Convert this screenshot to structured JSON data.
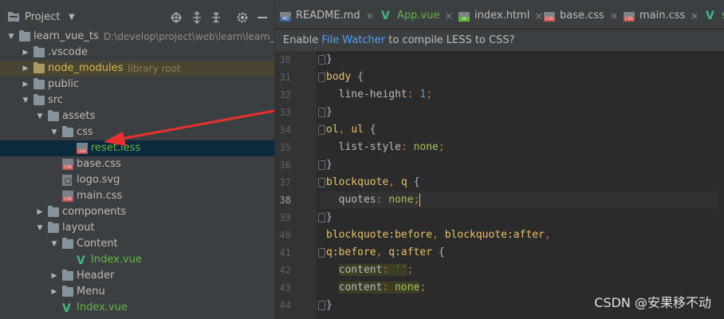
{
  "panel": {
    "title": "Project",
    "buttons": [
      "locate-icon",
      "expand-all-icon",
      "collapse-all-icon",
      "gear-icon",
      "hide-icon"
    ]
  },
  "tree": [
    {
      "label": "learn_vue_ts",
      "hint": "D:\\develop\\project\\web\\learn\\learn_vue",
      "kind": "folder",
      "depth": 0,
      "open": true
    },
    {
      "label": ".vscode",
      "kind": "folder",
      "depth": 1,
      "open": false
    },
    {
      "label": "node_modules",
      "hint": "library root",
      "kind": "folder-nm",
      "depth": 1,
      "open": false
    },
    {
      "label": "public",
      "kind": "folder",
      "depth": 1,
      "open": false
    },
    {
      "label": "src",
      "kind": "folder",
      "depth": 1,
      "open": true
    },
    {
      "label": "assets",
      "kind": "folder",
      "depth": 2,
      "open": true
    },
    {
      "label": "css",
      "kind": "folder",
      "depth": 3,
      "open": true
    },
    {
      "label": "reset.less",
      "kind": "less",
      "depth": 4
    },
    {
      "label": "base.css",
      "kind": "css",
      "depth": 3
    },
    {
      "label": "logo.svg",
      "kind": "svg",
      "depth": 3
    },
    {
      "label": "main.css",
      "kind": "css",
      "depth": 3
    },
    {
      "label": "components",
      "kind": "folder",
      "depth": 2,
      "open": false
    },
    {
      "label": "layout",
      "kind": "folder",
      "depth": 2,
      "open": true
    },
    {
      "label": "Content",
      "kind": "folder",
      "depth": 3,
      "open": true
    },
    {
      "label": "Index.vue",
      "kind": "vue",
      "depth": 4
    },
    {
      "label": "Header",
      "kind": "folder",
      "depth": 3,
      "open": false
    },
    {
      "label": "Menu",
      "kind": "folder",
      "depth": 3,
      "open": false
    },
    {
      "label": "Index.vue",
      "kind": "vue",
      "depth": 3
    }
  ],
  "tabs": [
    {
      "label": "README.md",
      "kind": "md"
    },
    {
      "label": "App.vue",
      "kind": "vue"
    },
    {
      "label": "index.html",
      "kind": "html"
    },
    {
      "label": "base.css",
      "kind": "css"
    },
    {
      "label": "main.css",
      "kind": "css"
    },
    {
      "label": "s",
      "kind": "vue"
    }
  ],
  "notice": {
    "before": "Enable ",
    "link": "File Watcher",
    "after": " to compile LESS to CSS?"
  },
  "code": {
    "current_line": 38,
    "lines": [
      {
        "n": "30",
        "tokens": [
          [
            "brace",
            "}"
          ]
        ]
      },
      {
        "n": "31",
        "tokens": [
          [
            "sel",
            "body"
          ],
          [
            "brace",
            " {"
          ]
        ]
      },
      {
        "n": "32",
        "tokens": [
          [
            "prop",
            "  line-height"
          ],
          [
            "pun",
            ": "
          ],
          [
            "num",
            "1"
          ],
          [
            "pun",
            ";"
          ]
        ]
      },
      {
        "n": "33",
        "tokens": [
          [
            "brace",
            "}"
          ]
        ]
      },
      {
        "n": "34",
        "tokens": [
          [
            "sel",
            "ol"
          ],
          [
            "pun",
            ", "
          ],
          [
            "sel",
            "ul"
          ],
          [
            "brace",
            " {"
          ]
        ]
      },
      {
        "n": "35",
        "tokens": [
          [
            "prop",
            "  list-style"
          ],
          [
            "pun",
            ": "
          ],
          [
            "val",
            "none"
          ],
          [
            "pun",
            ";"
          ]
        ]
      },
      {
        "n": "36",
        "tokens": [
          [
            "brace",
            "}"
          ]
        ]
      },
      {
        "n": "37",
        "tokens": [
          [
            "sel",
            "blockquote"
          ],
          [
            "pun",
            ", "
          ],
          [
            "sel",
            "q"
          ],
          [
            "brace",
            " {"
          ]
        ]
      },
      {
        "n": "38",
        "tokens": [
          [
            "prop",
            "  quotes"
          ],
          [
            "pun",
            ": "
          ],
          [
            "val",
            "none"
          ],
          [
            "pun",
            ";"
          ],
          [
            "caret",
            ""
          ]
        ]
      },
      {
        "n": "39",
        "tokens": [
          [
            "brace",
            "}"
          ]
        ]
      },
      {
        "n": "40",
        "tokens": [
          [
            "sel",
            "blockquote:before"
          ],
          [
            "pun",
            ", "
          ],
          [
            "sel",
            "blockquote:after"
          ],
          [
            "pun",
            ","
          ]
        ]
      },
      {
        "n": "41",
        "tokens": [
          [
            "sel",
            "q:before"
          ],
          [
            "pun",
            ", "
          ],
          [
            "sel",
            "q:after"
          ],
          [
            "brace",
            " {"
          ]
        ]
      },
      {
        "n": "42",
        "tokens": [
          [
            "prop",
            "  "
          ],
          [
            "hlprop",
            "content"
          ],
          [
            "hlpun",
            ": "
          ],
          [
            "hlstr",
            "''"
          ],
          [
            "pun",
            ";"
          ]
        ]
      },
      {
        "n": "43",
        "tokens": [
          [
            "prop",
            "  "
          ],
          [
            "hlprop",
            "content"
          ],
          [
            "hlpun",
            ": "
          ],
          [
            "hlval",
            "none"
          ],
          [
            "pun",
            ";"
          ]
        ]
      },
      {
        "n": "44",
        "tokens": [
          [
            "brace",
            "}"
          ]
        ]
      }
    ]
  },
  "watermark": "CSDN @安果移不动",
  "colors": {
    "panel_bg": "#3c3f41",
    "editor_bg": "#2b2b2b",
    "selected_row": "#0d293e",
    "annotation_arrow": "#e8312f"
  }
}
